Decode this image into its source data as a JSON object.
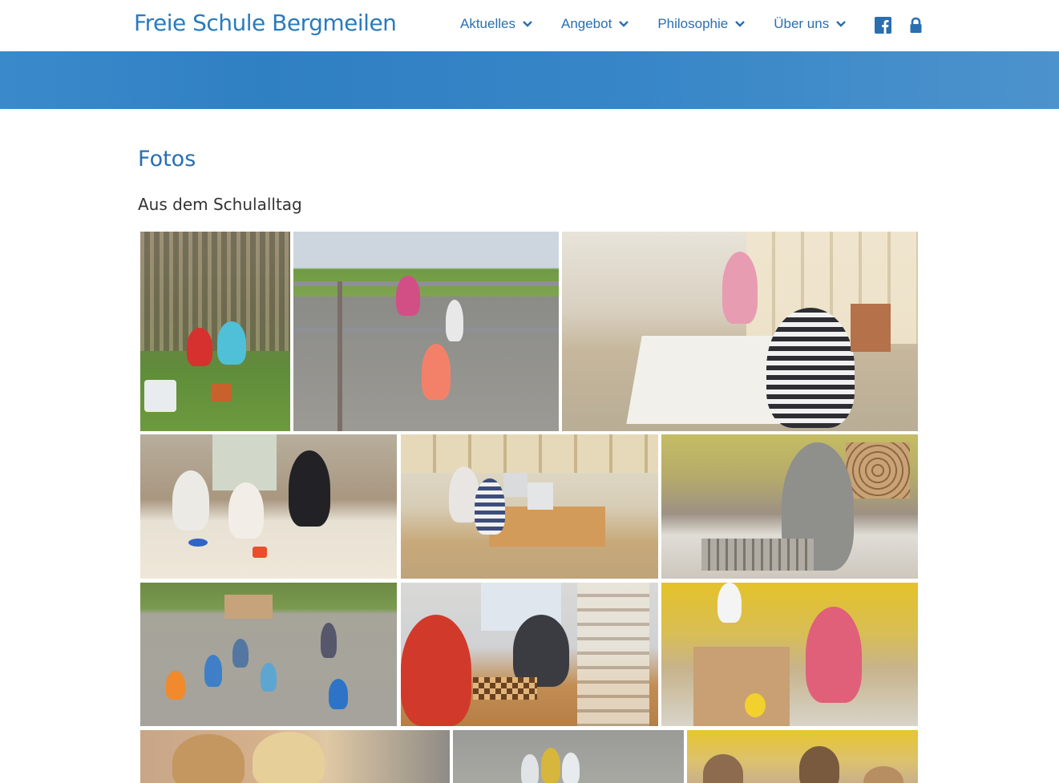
{
  "site": {
    "title": "Freie Schule Bergmeilen"
  },
  "nav": {
    "items": [
      {
        "label": "Aktuelles"
      },
      {
        "label": "Angebot"
      },
      {
        "label": "Philosophie"
      },
      {
        "label": "Über uns"
      }
    ],
    "icons": [
      "facebook-icon",
      "lock-icon"
    ]
  },
  "colors": {
    "brand": "#2a7bbd",
    "banner": "#2f7fc3",
    "link": "#2a6fb0"
  },
  "page": {
    "title": "Fotos",
    "subtitle": "Aus dem Schulalltag"
  },
  "gallery": {
    "photos": [
      {
        "subject": "garden-children-digging"
      },
      {
        "subject": "playground-climbing-bars"
      },
      {
        "subject": "girls-painting-banner"
      },
      {
        "subject": "crafting-table"
      },
      {
        "subject": "computer-desk"
      },
      {
        "subject": "workshop-girl"
      },
      {
        "subject": "schoolyard-circle"
      },
      {
        "subject": "boys-playing-chess"
      },
      {
        "subject": "workbench-girl"
      },
      {
        "subject": "closeup-children"
      },
      {
        "subject": "outdoor-group"
      },
      {
        "subject": "classroom-children"
      }
    ]
  }
}
